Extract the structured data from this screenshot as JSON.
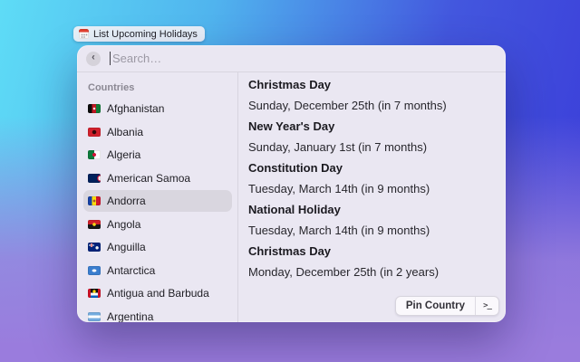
{
  "pill": {
    "label": "List Upcoming Holidays",
    "icon": "calendar-icon"
  },
  "search": {
    "placeholder": "Search…",
    "value": "",
    "back_icon": "chevron-left"
  },
  "sidebar": {
    "section_label": "Countries",
    "countries": [
      {
        "name": "Afghanistan",
        "flag": "af",
        "selected": false
      },
      {
        "name": "Albania",
        "flag": "al",
        "selected": false
      },
      {
        "name": "Algeria",
        "flag": "dz",
        "selected": false
      },
      {
        "name": "American Samoa",
        "flag": "as",
        "selected": false
      },
      {
        "name": "Andorra",
        "flag": "ad",
        "selected": true
      },
      {
        "name": "Angola",
        "flag": "ao",
        "selected": false
      },
      {
        "name": "Anguilla",
        "flag": "ai",
        "selected": false
      },
      {
        "name": "Antarctica",
        "flag": "aq",
        "selected": false
      },
      {
        "name": "Antigua and Barbuda",
        "flag": "ag",
        "selected": false
      },
      {
        "name": "Argentina",
        "flag": "ar",
        "selected": false
      }
    ]
  },
  "details": {
    "holidays": [
      {
        "title": "Christmas Day",
        "subtitle": "Sunday, December 25th (in 7 months)"
      },
      {
        "title": "New Year's Day",
        "subtitle": "Sunday, January 1st (in 7 months)"
      },
      {
        "title": "Constitution Day",
        "subtitle": "Tuesday, March 14th (in 9 months)"
      },
      {
        "title": "National Holiday",
        "subtitle": "Tuesday, March 14th (in 9 months)"
      },
      {
        "title": "Christmas Day",
        "subtitle": "Monday, December 25th (in 2 years)"
      }
    ]
  },
  "footer": {
    "action_label": "Pin Country",
    "shortcut_glyph": ">_"
  },
  "colors": {
    "bg_top_left": "#5edcf6",
    "bg_top_right": "#3a3bd9",
    "bg_bottom": "#9a7cdd",
    "window": "#eae7f2",
    "selection": "#d9d6df",
    "divider": "#d8d5df"
  }
}
